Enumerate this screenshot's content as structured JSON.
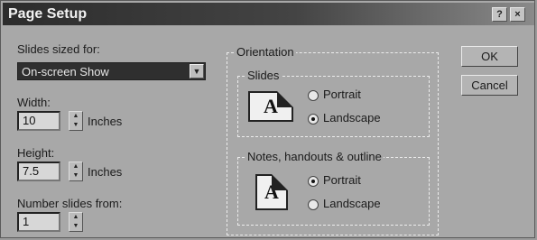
{
  "window": {
    "title": "Page Setup",
    "help_button": "?",
    "close_button": "×"
  },
  "slides_sized_for": {
    "label": "Slides sized for:",
    "value": "On-screen Show"
  },
  "width": {
    "label": "Width:",
    "value": "10",
    "unit": "Inches"
  },
  "height": {
    "label": "Height:",
    "value": "7.5",
    "unit": "Inches"
  },
  "number_slides_from": {
    "label": "Number slides from:",
    "value": "1"
  },
  "orientation": {
    "title": "Orientation",
    "slides": {
      "title": "Slides",
      "icon_letter": "A",
      "options": [
        "Portrait",
        "Landscape"
      ],
      "selected": "Landscape"
    },
    "notes": {
      "title": "Notes, handouts & outline",
      "icon_letter": "A",
      "options": [
        "Portrait",
        "Landscape"
      ],
      "selected": "Portrait"
    }
  },
  "buttons": {
    "ok": "OK",
    "cancel": "Cancel"
  }
}
